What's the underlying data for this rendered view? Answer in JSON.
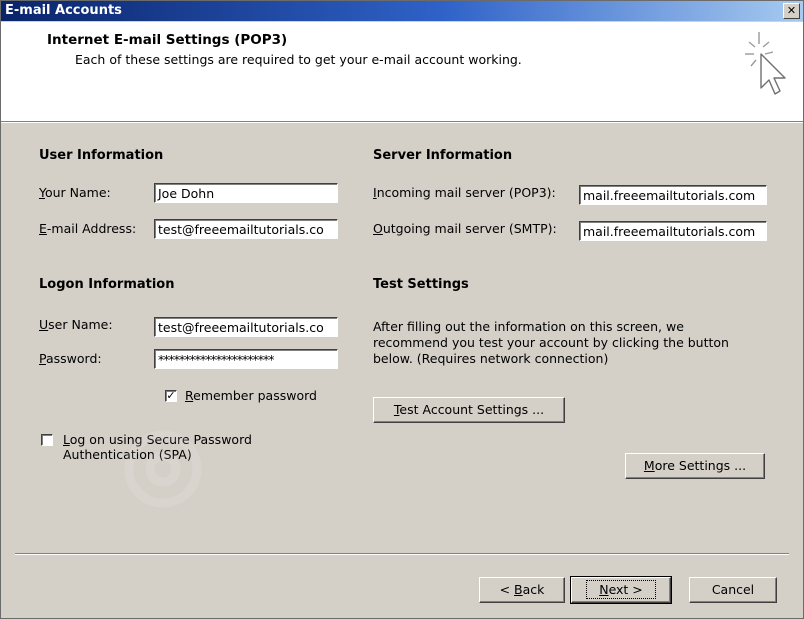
{
  "window": {
    "title": "E-mail Accounts",
    "close_glyph": "✕"
  },
  "header": {
    "title": "Internet E-mail Settings (POP3)",
    "subtitle": "Each of these settings are required to get your e-mail account working.",
    "icon": "cursor-sparkle-icon"
  },
  "user_info": {
    "title": "User Information",
    "name_label_m": "Y",
    "name_label_rest": "our Name:",
    "name_value": "Joe Dohn",
    "email_label_m": "E",
    "email_label_rest": "-mail Address:",
    "email_value": "test@freeemailtutorials.co"
  },
  "server_info": {
    "title": "Server Information",
    "incoming_label_m": "I",
    "incoming_label_rest": "ncoming mail server (POP3):",
    "incoming_value": "mail.freeemailtutorials.com",
    "outgoing_label_m": "O",
    "outgoing_label_rest": "utgoing mail server (SMTP):",
    "outgoing_value": "mail.freeemailtutorials.com"
  },
  "logon_info": {
    "title": "Logon Information",
    "user_label_m": "U",
    "user_label_rest": "ser Name:",
    "user_value": "test@freeemailtutorials.co",
    "password_label_m": "P",
    "password_label_rest": "assword:",
    "password_value": "**********************",
    "remember_checked": "✓",
    "remember_label_m": "R",
    "remember_label_rest": "emember password",
    "spa_label_m": "L",
    "spa_label_rest": "og on using Secure Password",
    "spa_label_line2": "Authentication (SPA)"
  },
  "test_settings": {
    "title": "Test Settings",
    "description": "After filling out the information on this screen, we recommend you test your account by clicking the button below. (Requires network connection)",
    "test_button_m": "T",
    "test_button_rest": "est Account Settings ...",
    "more_button_m": "M",
    "more_button_rest": "ore Settings ..."
  },
  "footer": {
    "back_prefix": "< ",
    "back_m": "B",
    "back_rest": "ack",
    "next_m": "N",
    "next_rest": "ext >",
    "cancel_label": "Cancel"
  }
}
